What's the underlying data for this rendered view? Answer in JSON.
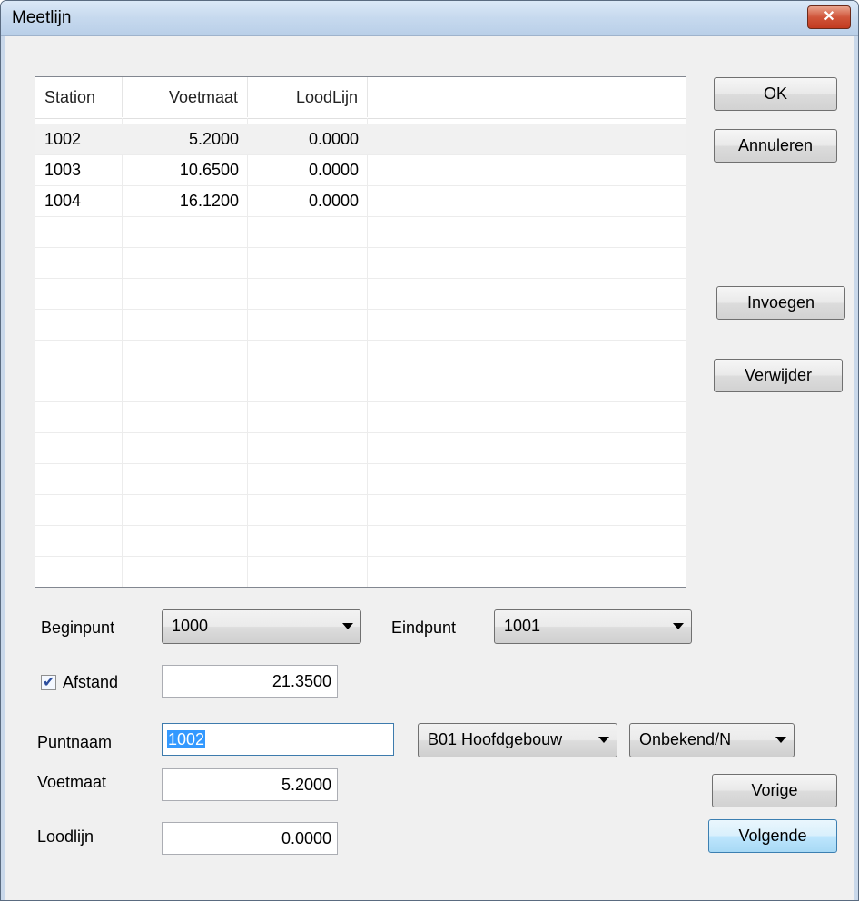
{
  "window": {
    "title": "Meetlijn",
    "close_glyph": "✕"
  },
  "table": {
    "columns": [
      "Station",
      "Voetmaat",
      "LoodLijn"
    ],
    "rows": [
      {
        "station": "1002",
        "voetmaat": "5.2000",
        "loodlijn": "0.0000"
      },
      {
        "station": "1003",
        "voetmaat": "10.6500",
        "loodlijn": "0.0000"
      },
      {
        "station": "1004",
        "voetmaat": "16.1200",
        "loodlijn": "0.0000"
      }
    ],
    "selected_row": 0
  },
  "buttons": {
    "ok": "OK",
    "annuleren": "Annuleren",
    "invoegen": "Invoegen",
    "verwijder": "Verwijder",
    "vorige": "Vorige",
    "volgende": "Volgende"
  },
  "form": {
    "beginpunt_label": "Beginpunt",
    "beginpunt_value": "1000",
    "eindpunt_label": "Eindpunt",
    "eindpunt_value": "1001",
    "afstand_label": "Afstand",
    "afstand_checked": true,
    "afstand_value": "21.3500",
    "puntnaam_label": "Puntnaam",
    "puntnaam_value": "1002",
    "gebouw_value": "B01 Hoofdgebouw",
    "type_value": "Onbekend/N",
    "voetmaat_label": "Voetmaat",
    "voetmaat_value": "5.2000",
    "loodlijn_label": "Loodlijn",
    "loodlijn_value": "0.0000"
  }
}
